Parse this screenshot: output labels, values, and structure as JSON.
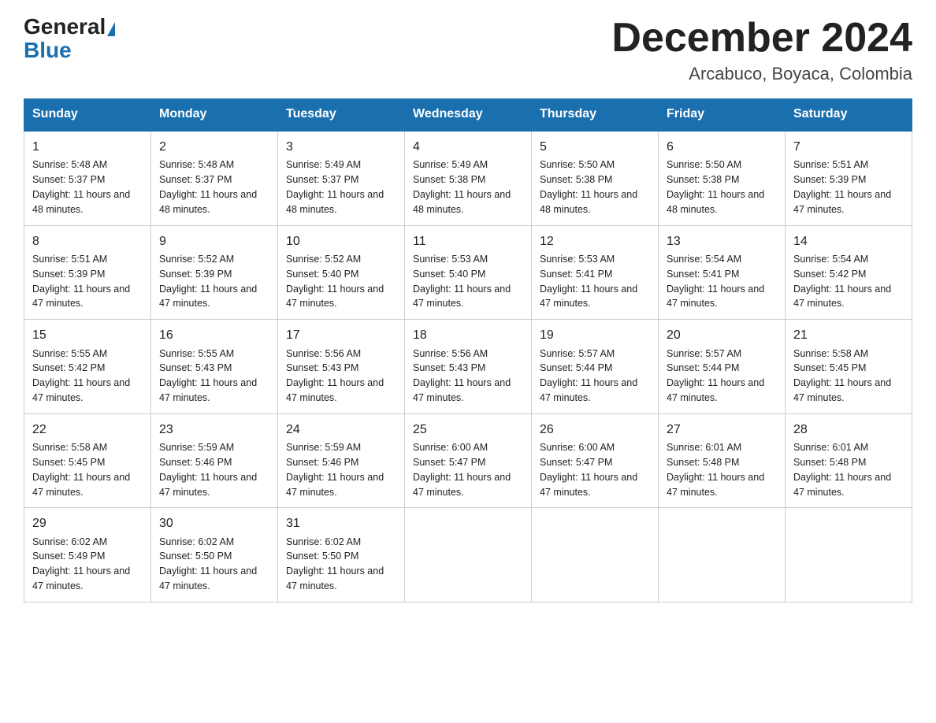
{
  "logo": {
    "general": "General",
    "blue": "Blue"
  },
  "title": "December 2024",
  "location": "Arcabuco, Boyaca, Colombia",
  "days_of_week": [
    "Sunday",
    "Monday",
    "Tuesday",
    "Wednesday",
    "Thursday",
    "Friday",
    "Saturday"
  ],
  "weeks": [
    [
      {
        "day": "1",
        "sunrise": "5:48 AM",
        "sunset": "5:37 PM",
        "daylight": "11 hours and 48 minutes."
      },
      {
        "day": "2",
        "sunrise": "5:48 AM",
        "sunset": "5:37 PM",
        "daylight": "11 hours and 48 minutes."
      },
      {
        "day": "3",
        "sunrise": "5:49 AM",
        "sunset": "5:37 PM",
        "daylight": "11 hours and 48 minutes."
      },
      {
        "day": "4",
        "sunrise": "5:49 AM",
        "sunset": "5:38 PM",
        "daylight": "11 hours and 48 minutes."
      },
      {
        "day": "5",
        "sunrise": "5:50 AM",
        "sunset": "5:38 PM",
        "daylight": "11 hours and 48 minutes."
      },
      {
        "day": "6",
        "sunrise": "5:50 AM",
        "sunset": "5:38 PM",
        "daylight": "11 hours and 48 minutes."
      },
      {
        "day": "7",
        "sunrise": "5:51 AM",
        "sunset": "5:39 PM",
        "daylight": "11 hours and 47 minutes."
      }
    ],
    [
      {
        "day": "8",
        "sunrise": "5:51 AM",
        "sunset": "5:39 PM",
        "daylight": "11 hours and 47 minutes."
      },
      {
        "day": "9",
        "sunrise": "5:52 AM",
        "sunset": "5:39 PM",
        "daylight": "11 hours and 47 minutes."
      },
      {
        "day": "10",
        "sunrise": "5:52 AM",
        "sunset": "5:40 PM",
        "daylight": "11 hours and 47 minutes."
      },
      {
        "day": "11",
        "sunrise": "5:53 AM",
        "sunset": "5:40 PM",
        "daylight": "11 hours and 47 minutes."
      },
      {
        "day": "12",
        "sunrise": "5:53 AM",
        "sunset": "5:41 PM",
        "daylight": "11 hours and 47 minutes."
      },
      {
        "day": "13",
        "sunrise": "5:54 AM",
        "sunset": "5:41 PM",
        "daylight": "11 hours and 47 minutes."
      },
      {
        "day": "14",
        "sunrise": "5:54 AM",
        "sunset": "5:42 PM",
        "daylight": "11 hours and 47 minutes."
      }
    ],
    [
      {
        "day": "15",
        "sunrise": "5:55 AM",
        "sunset": "5:42 PM",
        "daylight": "11 hours and 47 minutes."
      },
      {
        "day": "16",
        "sunrise": "5:55 AM",
        "sunset": "5:43 PM",
        "daylight": "11 hours and 47 minutes."
      },
      {
        "day": "17",
        "sunrise": "5:56 AM",
        "sunset": "5:43 PM",
        "daylight": "11 hours and 47 minutes."
      },
      {
        "day": "18",
        "sunrise": "5:56 AM",
        "sunset": "5:43 PM",
        "daylight": "11 hours and 47 minutes."
      },
      {
        "day": "19",
        "sunrise": "5:57 AM",
        "sunset": "5:44 PM",
        "daylight": "11 hours and 47 minutes."
      },
      {
        "day": "20",
        "sunrise": "5:57 AM",
        "sunset": "5:44 PM",
        "daylight": "11 hours and 47 minutes."
      },
      {
        "day": "21",
        "sunrise": "5:58 AM",
        "sunset": "5:45 PM",
        "daylight": "11 hours and 47 minutes."
      }
    ],
    [
      {
        "day": "22",
        "sunrise": "5:58 AM",
        "sunset": "5:45 PM",
        "daylight": "11 hours and 47 minutes."
      },
      {
        "day": "23",
        "sunrise": "5:59 AM",
        "sunset": "5:46 PM",
        "daylight": "11 hours and 47 minutes."
      },
      {
        "day": "24",
        "sunrise": "5:59 AM",
        "sunset": "5:46 PM",
        "daylight": "11 hours and 47 minutes."
      },
      {
        "day": "25",
        "sunrise": "6:00 AM",
        "sunset": "5:47 PM",
        "daylight": "11 hours and 47 minutes."
      },
      {
        "day": "26",
        "sunrise": "6:00 AM",
        "sunset": "5:47 PM",
        "daylight": "11 hours and 47 minutes."
      },
      {
        "day": "27",
        "sunrise": "6:01 AM",
        "sunset": "5:48 PM",
        "daylight": "11 hours and 47 minutes."
      },
      {
        "day": "28",
        "sunrise": "6:01 AM",
        "sunset": "5:48 PM",
        "daylight": "11 hours and 47 minutes."
      }
    ],
    [
      {
        "day": "29",
        "sunrise": "6:02 AM",
        "sunset": "5:49 PM",
        "daylight": "11 hours and 47 minutes."
      },
      {
        "day": "30",
        "sunrise": "6:02 AM",
        "sunset": "5:50 PM",
        "daylight": "11 hours and 47 minutes."
      },
      {
        "day": "31",
        "sunrise": "6:02 AM",
        "sunset": "5:50 PM",
        "daylight": "11 hours and 47 minutes."
      },
      null,
      null,
      null,
      null
    ]
  ]
}
